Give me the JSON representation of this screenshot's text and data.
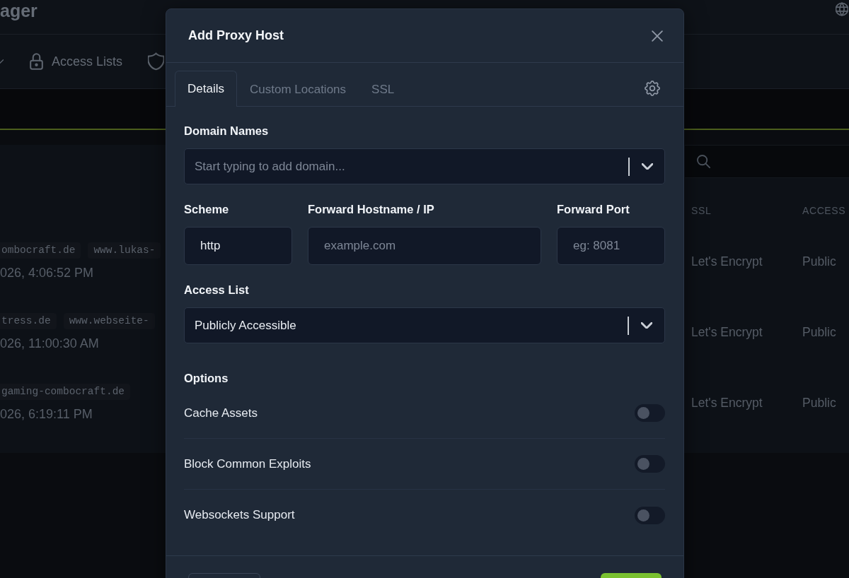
{
  "header": {
    "title": "ager"
  },
  "nav": {
    "items": [
      {
        "label": "Access Lists"
      }
    ]
  },
  "table": {
    "columns": [
      {
        "label": "SSL"
      },
      {
        "label": "ACCESS"
      }
    ],
    "rows": [
      {
        "domains": [
          "ombocraft.de",
          "www.lukas-"
        ],
        "date": "026, 4:06:52 PM",
        "ssl": "Let's Encrypt",
        "access": "Public"
      },
      {
        "domains": [
          "tress.de",
          "www.webseite-"
        ],
        "date": "026, 11:00:30 AM",
        "ssl": "Let's Encrypt",
        "access": "Public"
      },
      {
        "domains": [
          "gaming-combocraft.de"
        ],
        "date": "026, 6:19:11 PM",
        "ssl": "Let's Encrypt",
        "access": "Public"
      }
    ]
  },
  "modal": {
    "title": "Add Proxy Host",
    "tabs": [
      {
        "label": "Details",
        "selected": true
      },
      {
        "label": "Custom Locations",
        "selected": false
      },
      {
        "label": "SSL",
        "selected": false
      }
    ],
    "domain_names": {
      "label": "Domain Names",
      "placeholder": "Start typing to add domain..."
    },
    "scheme": {
      "label": "Scheme",
      "value": "http"
    },
    "forward_hostname": {
      "label": "Forward Hostname / IP",
      "placeholder": "example.com"
    },
    "forward_port": {
      "label": "Forward Port",
      "placeholder": "eg: 8081"
    },
    "access_list": {
      "label": "Access List",
      "value": "Publicly Accessible"
    },
    "options": {
      "title": "Options",
      "items": [
        {
          "label": "Cache Assets",
          "on": false
        },
        {
          "label": "Block Common Exploits",
          "on": false
        },
        {
          "label": "Websockets Support",
          "on": false
        }
      ]
    },
    "footer_buttons": [
      {
        "kind": "secondary"
      },
      {
        "kind": "primary"
      }
    ]
  }
}
